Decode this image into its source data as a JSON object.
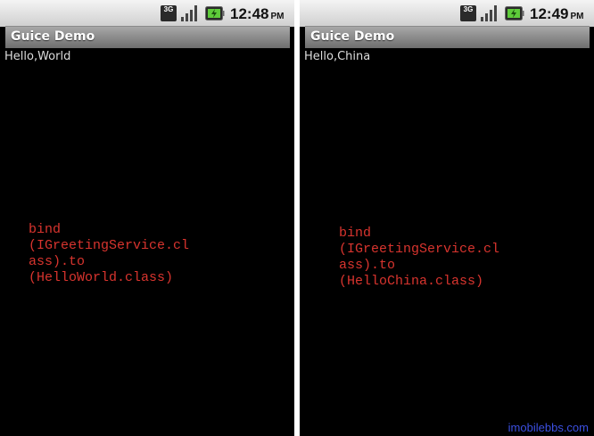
{
  "phones": [
    {
      "status": {
        "network": "3G",
        "time": "12:48",
        "ampm": "PM"
      },
      "title": "Guice Demo",
      "content": "Hello,World",
      "code": "bind\n(IGreetingService.cl\nass).to\n(HelloWorld.class)"
    },
    {
      "status": {
        "network": "3G",
        "time": "12:49",
        "ampm": "PM"
      },
      "title": "Guice Demo",
      "content": "Hello,China",
      "code": "bind\n(IGreetingService.cl\nass).to\n(HelloChina.class)"
    }
  ],
  "watermark": "imobilebbs.com",
  "icons": [
    "3g-network-icon",
    "signal-strength-icon",
    "battery-charging-icon"
  ],
  "colors": {
    "code_text": "#d8342e",
    "watermark": "#3b4fe0",
    "screen_bg": "#000000"
  }
}
